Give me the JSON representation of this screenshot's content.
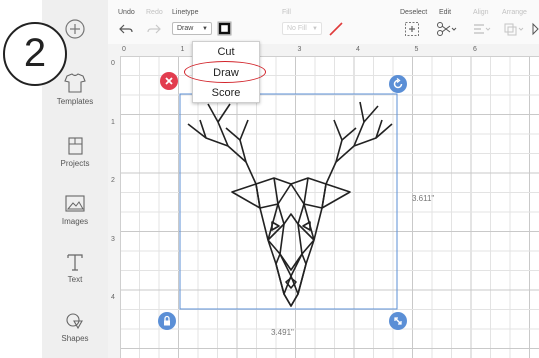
{
  "step": {
    "number": "2"
  },
  "sidebar": {
    "items": [
      {
        "label": "Templates",
        "icon": "shirt-template-icon"
      },
      {
        "label": "Projects",
        "icon": "projects-icon"
      },
      {
        "label": "Images",
        "icon": "images-icon"
      },
      {
        "label": "Text",
        "icon": "text-icon"
      },
      {
        "label": "Shapes",
        "icon": "shapes-icon"
      }
    ]
  },
  "toolbar": {
    "undo_label": "Undo",
    "redo_label": "Redo",
    "linetype_label": "Linetype",
    "linetype_value": "Draw",
    "fill_label": "Fill",
    "fill_value": "No Fill",
    "deselect_label": "Deselect",
    "edit_label": "Edit",
    "align_label": "Align",
    "arrange_label": "Arrange",
    "pen_color": "#e03a3a"
  },
  "linetype_menu": {
    "options": [
      "Cut",
      "Draw",
      "Score"
    ],
    "highlighted": "Draw"
  },
  "ruler": {
    "top": [
      "0",
      "1",
      "2",
      "3",
      "4",
      "5",
      "6"
    ],
    "left": [
      "0",
      "1",
      "2",
      "3",
      "4"
    ]
  },
  "selection": {
    "width_label": "3.491\"",
    "height_label": "3.611\""
  },
  "colors": {
    "accent_blue": "#5b8fd6",
    "delete_red": "#e23d4f",
    "highlight_red": "#d2232a"
  }
}
